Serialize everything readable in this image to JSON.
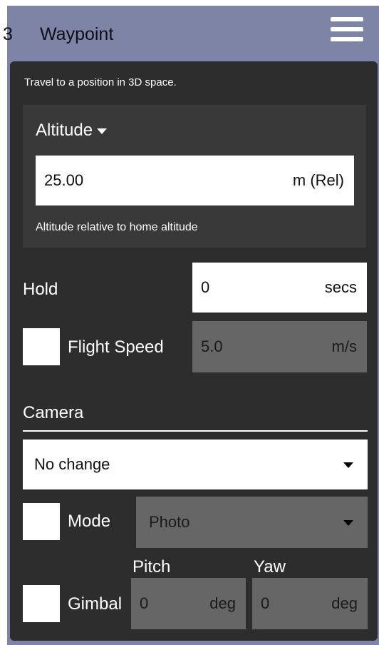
{
  "header": {
    "number": "3",
    "title": "Waypoint",
    "menu_icon": "hamburger-menu-icon"
  },
  "colors": {
    "header_bg": "#7e84a5",
    "panel_bg": "#2d2d2d",
    "section_bg": "#393939",
    "field_bg": "#ffffff",
    "disabled_field_bg": "#666666"
  },
  "description": "Travel to a position in 3D space.",
  "altitude": {
    "mode_label": "Altitude",
    "value": "25.00",
    "unit": "m (Rel)",
    "hint": "Altitude relative to home altitude"
  },
  "hold": {
    "label": "Hold",
    "value": "0",
    "unit": "secs"
  },
  "flight_speed": {
    "label": "Flight Speed",
    "checked": false,
    "value": "5.0",
    "unit": "m/s"
  },
  "camera": {
    "section_label": "Camera",
    "action": "No change",
    "mode_label": "Mode",
    "mode_checked": false,
    "mode_value": "Photo"
  },
  "gimbal": {
    "label": "Gimbal",
    "checked": false,
    "pitch_label": "Pitch",
    "pitch_value": "0",
    "pitch_unit": "deg",
    "yaw_label": "Yaw",
    "yaw_value": "0",
    "yaw_unit": "deg"
  }
}
